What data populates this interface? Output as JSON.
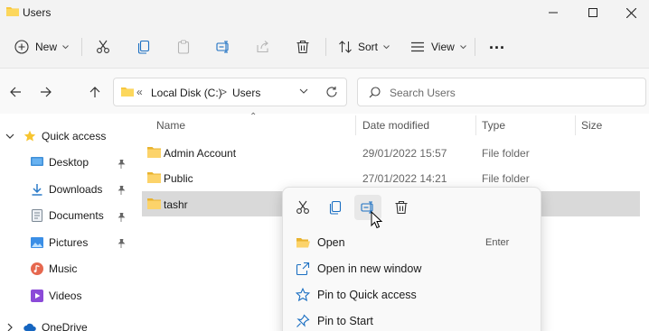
{
  "window": {
    "title": "Users"
  },
  "toolbar": {
    "new_label": "New",
    "sort_label": "Sort",
    "view_label": "View",
    "more_label": "..."
  },
  "address": {
    "overflow": "«",
    "crumbs": [
      "Local Disk (C:)",
      "Users"
    ],
    "separator": ">"
  },
  "search": {
    "placeholder": "Search Users"
  },
  "nav": {
    "quick_access": "Quick access",
    "items": [
      {
        "label": "Desktop",
        "icon": "desktop-icon",
        "pinned": true
      },
      {
        "label": "Downloads",
        "icon": "download-icon",
        "pinned": true
      },
      {
        "label": "Documents",
        "icon": "document-icon",
        "pinned": true
      },
      {
        "label": "Pictures",
        "icon": "picture-icon",
        "pinned": true
      },
      {
        "label": "Music",
        "icon": "music-icon",
        "pinned": false
      },
      {
        "label": "Videos",
        "icon": "video-icon",
        "pinned": false
      }
    ],
    "onedrive": "OneDrive"
  },
  "files": {
    "columns": [
      "Name",
      "Date modified",
      "Type",
      "Size"
    ],
    "rows": [
      {
        "name": "Admin Account",
        "date": "29/01/2022 15:57",
        "type": "File folder",
        "selected": false
      },
      {
        "name": "Public",
        "date": "27/01/2022 14:21",
        "type": "File folder",
        "selected": false
      },
      {
        "name": "tashr",
        "date": "",
        "type": "",
        "selected": true
      }
    ]
  },
  "context_menu": {
    "icons": [
      "cut-icon",
      "copy-icon",
      "rename-icon",
      "delete-icon"
    ],
    "items": [
      {
        "label": "Open",
        "shortcut": "Enter",
        "icon": "folder-open-icon"
      },
      {
        "label": "Open in new window",
        "shortcut": "",
        "icon": "new-window-icon"
      },
      {
        "label": "Pin to Quick access",
        "shortcut": "",
        "icon": "star-icon"
      },
      {
        "label": "Pin to Start",
        "shortcut": "",
        "icon": "pin-icon"
      }
    ]
  },
  "colors": {
    "folder": "#f8c73e",
    "accent": "#0067c0",
    "selected_row": "#d9d9d9",
    "chrome": "#f3f3f3"
  }
}
